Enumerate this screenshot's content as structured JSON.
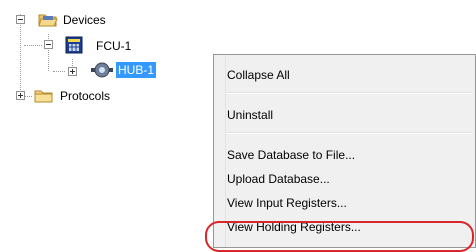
{
  "tree": {
    "devices": {
      "label": "Devices",
      "icon": "open-folder-icon",
      "expanded": true
    },
    "fcu": {
      "label": "FCU-1",
      "icon": "fcu-device-icon",
      "expanded": true
    },
    "hub": {
      "label": "HUB-1",
      "icon": "hub-device-icon",
      "selected": true,
      "expanded": false
    },
    "protocols": {
      "label": "Protocols",
      "icon": "folder-icon",
      "expanded": false
    }
  },
  "context_menu": {
    "items": [
      {
        "label": "Collapse All"
      },
      {
        "label": "Uninstall"
      },
      {
        "label": "Save Database to File..."
      },
      {
        "label": "Upload Database..."
      },
      {
        "label": "View Input Registers..."
      },
      {
        "label": "View Holding Registers...",
        "circled": true
      }
    ]
  },
  "colors": {
    "selection": "#3399ff",
    "highlight_ring": "#d9262b",
    "menu_background": "#f0f0f0"
  }
}
